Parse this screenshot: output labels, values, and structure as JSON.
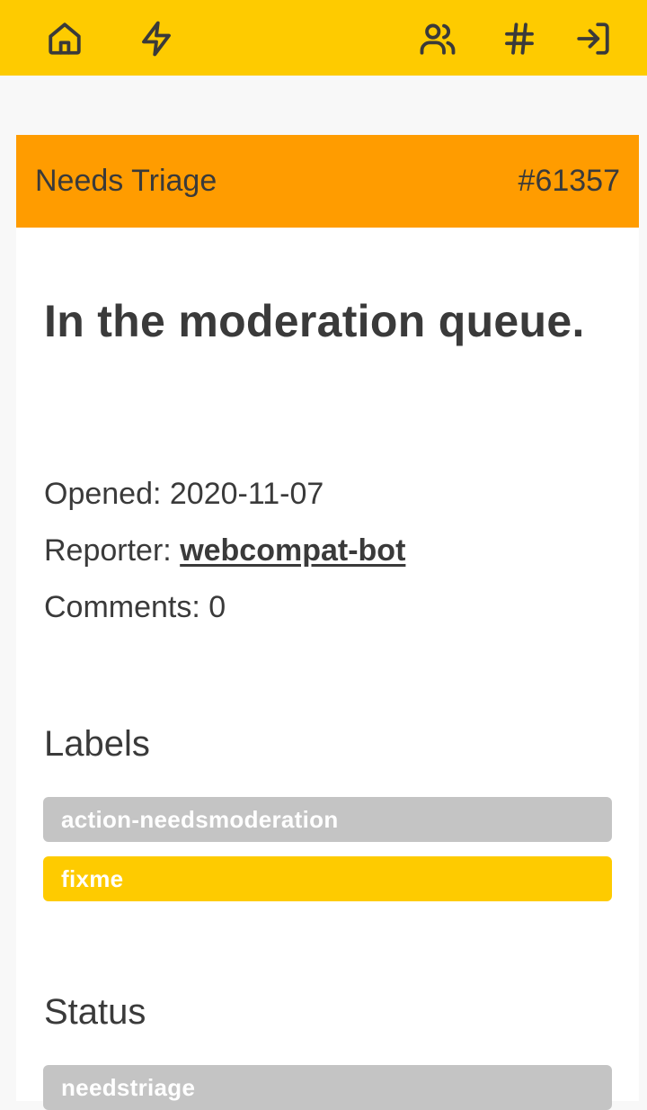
{
  "nav": {
    "home_icon": "home-icon",
    "activity_icon": "lightning-icon",
    "users_icon": "users-icon",
    "hash_icon": "hash-icon",
    "login_icon": "login-icon"
  },
  "issue": {
    "status": "Needs Triage",
    "number": "#61357",
    "title": "In the moderation queue.",
    "opened_label": "Opened: ",
    "opened_value": "2020-11-07",
    "reporter_label": "Reporter: ",
    "reporter_value": "webcompat-bot",
    "comments_label": "Comments: ",
    "comments_value": "0"
  },
  "labels_section": {
    "heading": "Labels",
    "items": [
      {
        "text": "action-needsmoderation",
        "color": "#c4c4c4"
      },
      {
        "text": "fixme",
        "color": "#fecb00"
      }
    ]
  },
  "status_section": {
    "heading": "Status",
    "items": [
      {
        "text": "needstriage",
        "color": "#c4c4c4"
      }
    ]
  },
  "colors": {
    "topbar": "#fecb00",
    "header": "#ff9c00",
    "text": "#3a3a3a"
  }
}
